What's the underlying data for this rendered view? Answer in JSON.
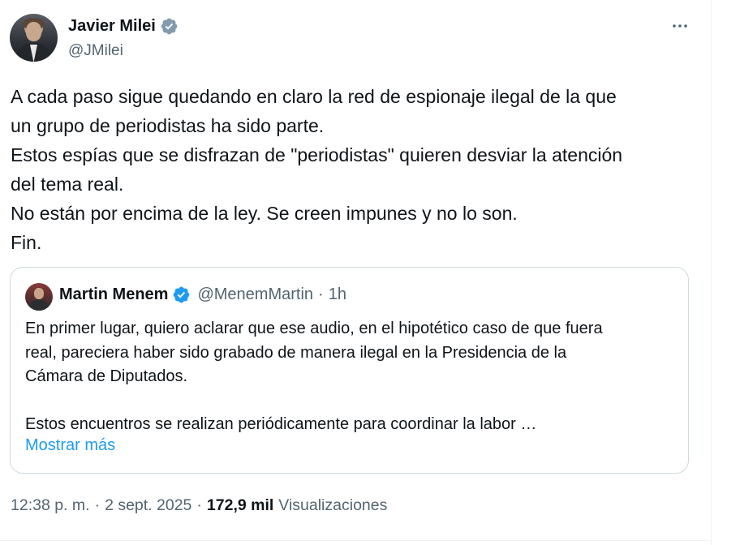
{
  "post": {
    "author_name": "Javier Milei",
    "author_handle": "@JMilei",
    "text": "A cada paso sigue quedando en claro la red de espionaje ilegal de la que\nun grupo de periodistas ha sido parte.\nEstos espías que se disfrazan de \"periodistas\" quieren desviar la atención\ndel tema real.\nNo están por encima de la ley. Se creen impunes y no lo son.\nFin.",
    "time": "12:38 p. m.",
    "date": "2 sept. 2025",
    "separator": "·",
    "views_count": "172,9 mil",
    "views_label": "Visualizaciones",
    "verified_color": "#1d9bf0"
  },
  "quote": {
    "author_name": "Martin Menem",
    "author_handle": "@MenemMartin",
    "separator": "·",
    "time": "1h",
    "text": "En primer lugar, quiero aclarar que ese audio, en el hipotético caso de que fuera\nreal, pareciera haber sido grabado de manera ilegal en la Presidencia de la\nCámara de Diputados.\n\nEstos encuentros se realizan periódicamente para coordinar la labor …",
    "show_more": "Mostrar más"
  },
  "icons": {
    "verified": "verified-badge-icon",
    "more": "more-horizontal-icon"
  }
}
